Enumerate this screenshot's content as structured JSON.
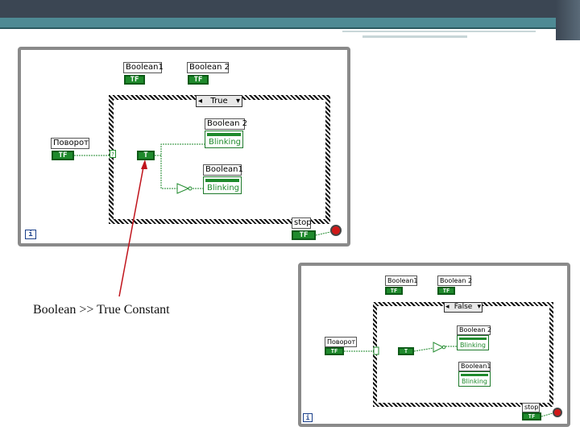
{
  "top_diagram": {
    "controls": {
      "boolean1_label": "Boolean1",
      "boolean2_label": "Boolean 2",
      "povorot_label": "Поворот",
      "stop_label": "stop",
      "tf_label": "TF"
    },
    "case_selector": "True",
    "constant_label": "T",
    "indicators": {
      "boolean2_label": "Boolean 2",
      "boolean1_label": "Boolean1",
      "blink_text": "Blinking"
    },
    "loop_index": "i"
  },
  "caption": "Boolean >> True Constant",
  "bottom_diagram": {
    "controls": {
      "boolean1_label": "Boolean1",
      "boolean2_label": "Boolean 2",
      "povorot_label": "Поворот",
      "stop_label": "stop",
      "tf_label": "TF"
    },
    "case_selector": "False",
    "constant_label": "T",
    "indicators": {
      "boolean2_label": "Boolean 2",
      "boolean1_label": "Boolean1",
      "blink_text": "Blinking"
    },
    "loop_index": "i"
  },
  "colors": {
    "wire": "#1f8a2c",
    "annotation_arrow": "#c0141c",
    "panel_border": "#8a8a8a"
  }
}
